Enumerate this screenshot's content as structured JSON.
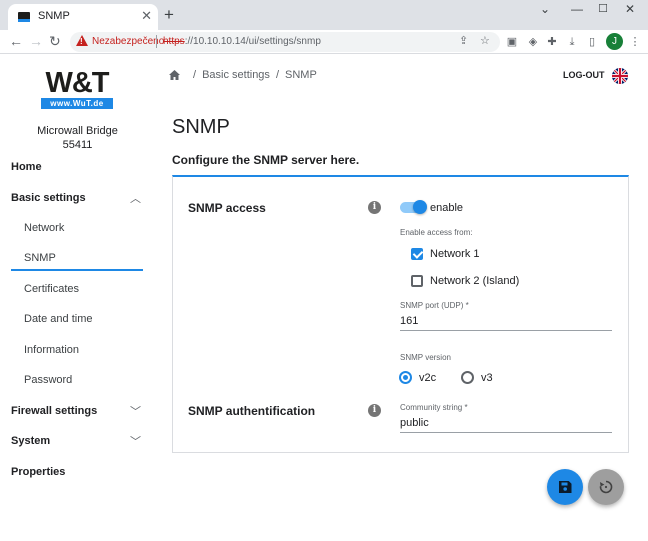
{
  "browser": {
    "tab_title": "SNMP",
    "tab_close": "✕",
    "new_tab": "+",
    "security_warning": "Nezabezpečeno",
    "url_scheme": "https",
    "url_rest": "://10.10.10.14/ui/settings/snmp",
    "profile_initial": "J"
  },
  "sidebar": {
    "logo_text": "W&T",
    "logo_subtext": "www.WuT.de",
    "device_name": "Microwall Bridge",
    "device_id": "55411",
    "items": [
      {
        "label": "Home",
        "level": "top"
      },
      {
        "label": "Basic settings",
        "level": "top",
        "expanded": true
      },
      {
        "label": "Network",
        "level": "sub"
      },
      {
        "label": "SNMP",
        "level": "sub",
        "active": true
      },
      {
        "label": "Certificates",
        "level": "sub"
      },
      {
        "label": "Date and time",
        "level": "sub"
      },
      {
        "label": "Information",
        "level": "sub"
      },
      {
        "label": "Password",
        "level": "sub"
      },
      {
        "label": "Firewall settings",
        "level": "top",
        "expanded": false
      },
      {
        "label": "System",
        "level": "top",
        "expanded": false
      },
      {
        "label": "Properties",
        "level": "top"
      }
    ]
  },
  "header": {
    "breadcrumb": [
      "Basic settings",
      "SNMP"
    ],
    "logout_label": "LOG-OUT"
  },
  "main": {
    "title": "SNMP",
    "subtitle": "Configure the SNMP server here.",
    "snmp_access": {
      "title": "SNMP access",
      "enable_label": "enable",
      "enabled": true,
      "access_from_label": "Enable access from:",
      "networks": [
        {
          "label": "Network 1",
          "checked": true
        },
        {
          "label": "Network 2 (Island)",
          "checked": false
        }
      ],
      "port_label": "SNMP port (UDP) *",
      "port_value": "161",
      "version_label": "SNMP version",
      "versions": [
        {
          "label": "v2c",
          "selected": true
        },
        {
          "label": "v3",
          "selected": false
        }
      ]
    },
    "snmp_auth": {
      "title": "SNMP authentification",
      "community_label": "Community string *",
      "community_value": "public"
    }
  },
  "colors": {
    "accent": "#1e88e5",
    "fab_reset": "#9e9e9e"
  }
}
